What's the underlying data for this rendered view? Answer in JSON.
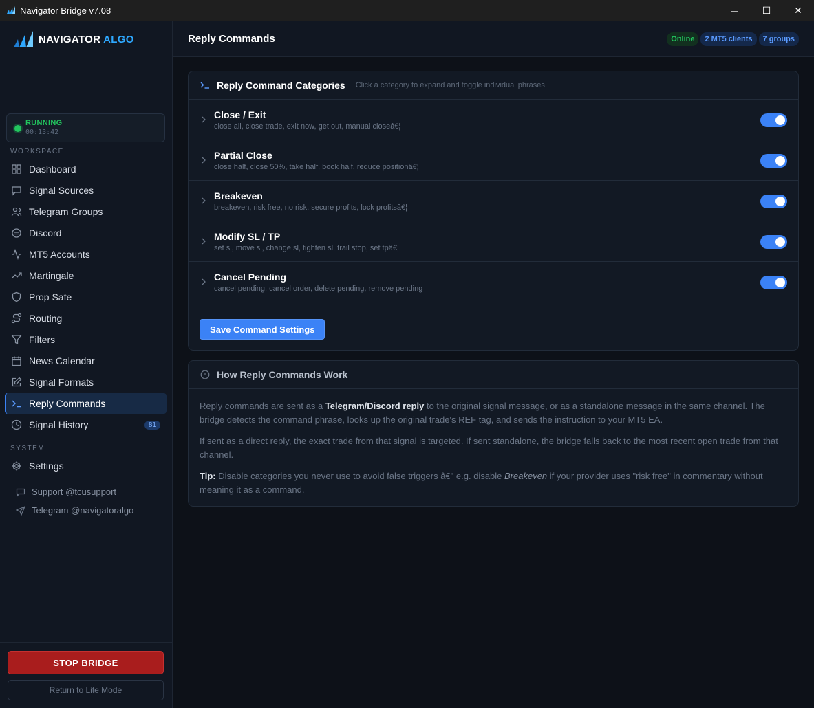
{
  "window": {
    "title": "Navigator Bridge v7.08",
    "minimize": "─",
    "maximize": "☐",
    "close": "✕"
  },
  "brand": {
    "name_part1": "NAVIGATOR",
    "name_part2": "ALGO",
    "accent_color": "#2ea8ff"
  },
  "status": {
    "state": "RUNNING",
    "uptime": "00:13:42",
    "color": "#22c55e"
  },
  "sidebar": {
    "workspace_label": "WORKSPACE",
    "system_label": "SYSTEM",
    "items": [
      {
        "label": "Dashboard",
        "icon": "grid-icon"
      },
      {
        "label": "Signal Sources",
        "icon": "message-square-icon"
      },
      {
        "label": "Telegram Groups",
        "icon": "users-icon"
      },
      {
        "label": "Discord",
        "icon": "discord-icon"
      },
      {
        "label": "MT5 Accounts",
        "icon": "activity-icon"
      },
      {
        "label": "Martingale",
        "icon": "trending-up-icon"
      },
      {
        "label": "Prop Safe",
        "icon": "shield-icon"
      },
      {
        "label": "Routing",
        "icon": "route-icon"
      },
      {
        "label": "Filters",
        "icon": "filter-icon"
      },
      {
        "label": "News Calendar",
        "icon": "calendar-icon"
      },
      {
        "label": "Signal Formats",
        "icon": "edit-icon"
      },
      {
        "label": "Reply Commands",
        "icon": "terminal-icon",
        "active": true
      },
      {
        "label": "Signal History",
        "icon": "clock-icon",
        "count": "81"
      }
    ],
    "system_items": [
      {
        "label": "Settings",
        "icon": "gear-icon"
      }
    ],
    "support": "Support @tcusupport",
    "telegram": "Telegram @navigatoralgo",
    "stop_button": "STOP BRIDGE",
    "lite_button": "Return to Lite Mode"
  },
  "header": {
    "title": "Reply Commands",
    "badges": [
      "Online",
      "2 MT5 clients",
      "7 groups"
    ]
  },
  "categories_panel": {
    "title": "Reply Command Categories",
    "hint": "Click a category to expand and toggle individual phrases",
    "categories": [
      {
        "name": "Close / Exit",
        "phrases": "close all, close trade, exit now, get out, manual closeâ€¦",
        "enabled": true
      },
      {
        "name": "Partial Close",
        "phrases": "close half, close 50%, take half, book half, reduce positionâ€¦",
        "enabled": true
      },
      {
        "name": "Breakeven",
        "phrases": "breakeven, risk free, no risk, secure profits, lock profitsâ€¦",
        "enabled": true
      },
      {
        "name": "Modify SL / TP",
        "phrases": "set sl, move sl, change sl, tighten sl, trail stop, set tpâ€¦",
        "enabled": true
      },
      {
        "name": "Cancel Pending",
        "phrases": "cancel pending, cancel order, delete pending, remove pending",
        "enabled": true
      }
    ],
    "save_button": "Save Command Settings"
  },
  "help_panel": {
    "title": "How Reply Commands Work",
    "p1_a": "Reply commands are sent as a ",
    "p1_b": "Telegram/Discord reply",
    "p1_c": " to the original signal message, or as a standalone message in the same channel. The bridge detects the command phrase, looks up the original trade's REF tag, and sends the instruction to your MT5 EA.",
    "p2": "If sent as a direct reply, the exact trade from that signal is targeted. If sent standalone, the bridge falls back to the most recent open trade from that channel.",
    "p3_a": "Tip:",
    "p3_b": " Disable categories you never use to avoid false triggers â€\" e.g. disable ",
    "p3_c": "Breakeven",
    "p3_d": " if your provider uses \"risk free\" in commentary without meaning it as a command."
  }
}
